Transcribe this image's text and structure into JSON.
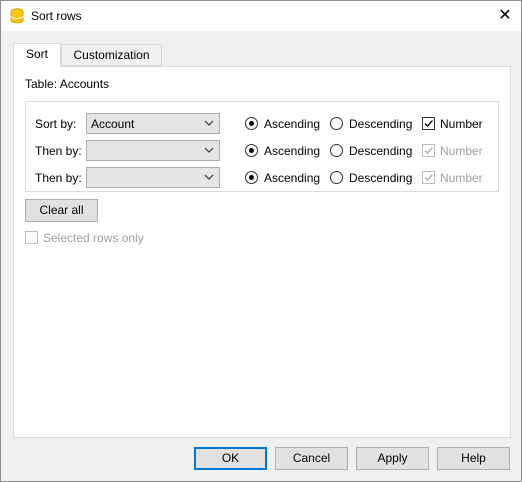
{
  "window": {
    "title": "Sort rows",
    "close_glyph": "✕"
  },
  "tabs": [
    {
      "label": "Sort",
      "active": true
    },
    {
      "label": "Customization",
      "active": false
    }
  ],
  "table_label": "Table: Accounts",
  "sort_rows": [
    {
      "label": "Sort by:",
      "value": "Account",
      "order": "ascending",
      "number_checked": true,
      "number_enabled": true
    },
    {
      "label": "Then by:",
      "value": "",
      "order": "ascending",
      "number_checked": true,
      "number_enabled": false
    },
    {
      "label": "Then by:",
      "value": "",
      "order": "ascending",
      "number_checked": true,
      "number_enabled": false
    }
  ],
  "options": {
    "ascending": "Ascending",
    "descending": "Descending",
    "number": "Number"
  },
  "clear_all": "Clear all",
  "selected_rows_only": {
    "label": "Selected rows only",
    "checked": false,
    "enabled": false
  },
  "buttons": {
    "ok": "OK",
    "cancel": "Cancel",
    "apply": "Apply",
    "help": "Help"
  },
  "colors": {
    "accent": "#0078d7",
    "icon": "#f5c518"
  }
}
